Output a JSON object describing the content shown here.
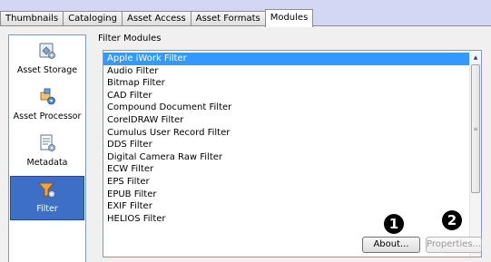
{
  "tabs": [
    {
      "label": "Thumbnails"
    },
    {
      "label": "Cataloging"
    },
    {
      "label": "Asset Access"
    },
    {
      "label": "Asset Formats"
    },
    {
      "label": "Modules",
      "active": true
    }
  ],
  "modules": [
    {
      "label": "Asset Storage",
      "icon": "asset-storage-icon"
    },
    {
      "label": "Asset Processor",
      "icon": "asset-processor-icon"
    },
    {
      "label": "Metadata",
      "icon": "metadata-icon"
    },
    {
      "label": "Filter",
      "icon": "filter-icon",
      "selected": true
    }
  ],
  "filter_modules": {
    "title": "Filter Modules",
    "items": [
      "Apple iWork Filter",
      "Audio Filter",
      "Bitmap Filter",
      "CAD Filter",
      "Compound Document Filter",
      "CorelDRAW Filter",
      "Cumulus User Record Filter",
      "DDS Filter",
      "Digital Camera Raw Filter",
      "ECW Filter",
      "EPS Filter",
      "EPUB Filter",
      "EXIF Filter",
      "HELIOS Filter"
    ],
    "selected_index": 0
  },
  "buttons": {
    "about": "About...",
    "properties": "Properties..."
  },
  "callouts": [
    "1",
    "2"
  ],
  "colors": {
    "selection": "#3399ff",
    "module_selection": "#3d6fc6",
    "background": "#f0f0f0"
  }
}
